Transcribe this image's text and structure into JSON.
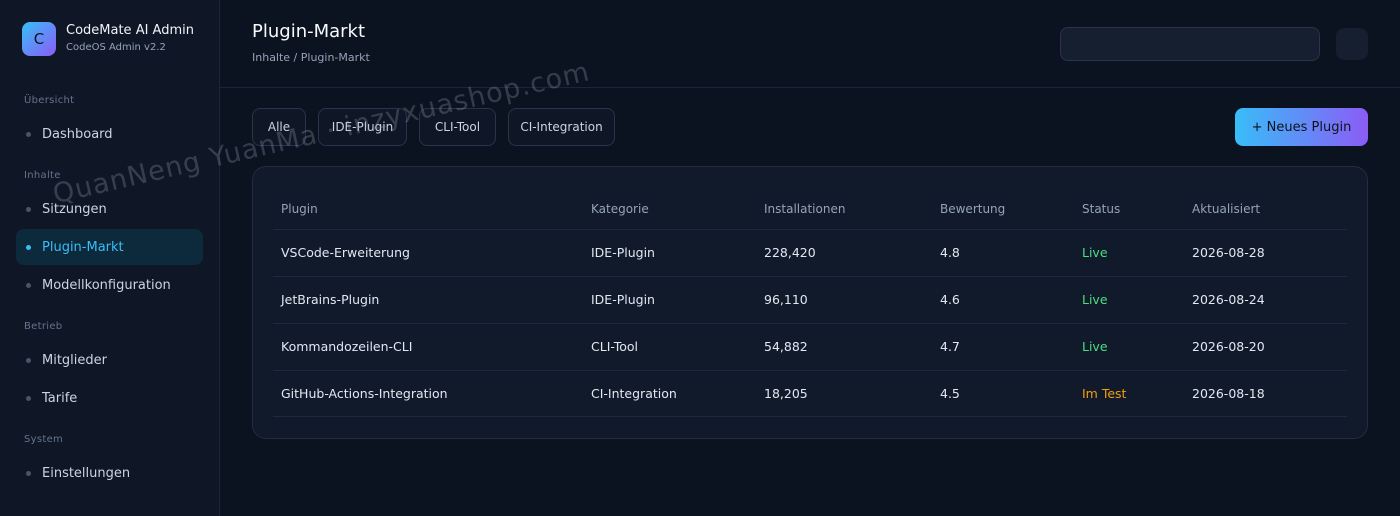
{
  "brand": {
    "logo_letter": "C",
    "title": "CodeMate AI Admin",
    "subtitle": "CodeOS Admin v2.2"
  },
  "sidebar": {
    "sections": [
      {
        "label": "Übersicht"
      },
      {
        "label": "Inhalte"
      },
      {
        "label": "Betrieb"
      },
      {
        "label": "System"
      }
    ],
    "items": [
      {
        "label": "Dashboard",
        "active": false
      },
      {
        "label": "Sitzungen",
        "active": false
      },
      {
        "label": "Plugin-Markt",
        "active": true
      },
      {
        "label": "Modellkonfiguration",
        "active": false
      },
      {
        "label": "Mitglieder",
        "active": false
      },
      {
        "label": "Tarife",
        "active": false
      },
      {
        "label": "Einstellungen",
        "active": false
      }
    ]
  },
  "header": {
    "title": "Plugin-Markt",
    "breadcrumb": "Inhalte / Plugin-Markt",
    "search_value": ""
  },
  "filters": [
    "Alle",
    "IDE-Plugin",
    "CLI-Tool",
    "CI-Integration"
  ],
  "new_button_label": "+ Neues Plugin",
  "table": {
    "columns": [
      "Plugin",
      "Kategorie",
      "Installationen",
      "Bewertung",
      "Status",
      "Aktualisiert"
    ],
    "rows": [
      {
        "plugin": "VSCode-Erweiterung",
        "category": "IDE-Plugin",
        "installs": "228,420",
        "rating": "4.8",
        "status": "Live",
        "updated": "2026-08-28"
      },
      {
        "plugin": "JetBrains-Plugin",
        "category": "IDE-Plugin",
        "installs": "96,110",
        "rating": "4.6",
        "status": "Live",
        "updated": "2026-08-24"
      },
      {
        "plugin": "Kommandozeilen-CLI",
        "category": "CLI-Tool",
        "installs": "54,882",
        "rating": "4.7",
        "status": "Live",
        "updated": "2026-08-20"
      },
      {
        "plugin": "GitHub-Actions-Integration",
        "category": "CI-Integration",
        "installs": "18,205",
        "rating": "4.5",
        "status": "Im Test",
        "updated": "2026-08-18"
      }
    ]
  },
  "colors": {
    "accent": "#38bdf8",
    "accent_end": "#8b5cf6",
    "live": "#4ade80",
    "test": "#f59e0b"
  },
  "watermark": "QuanNeng YuanMa · inzyxuashop.com"
}
